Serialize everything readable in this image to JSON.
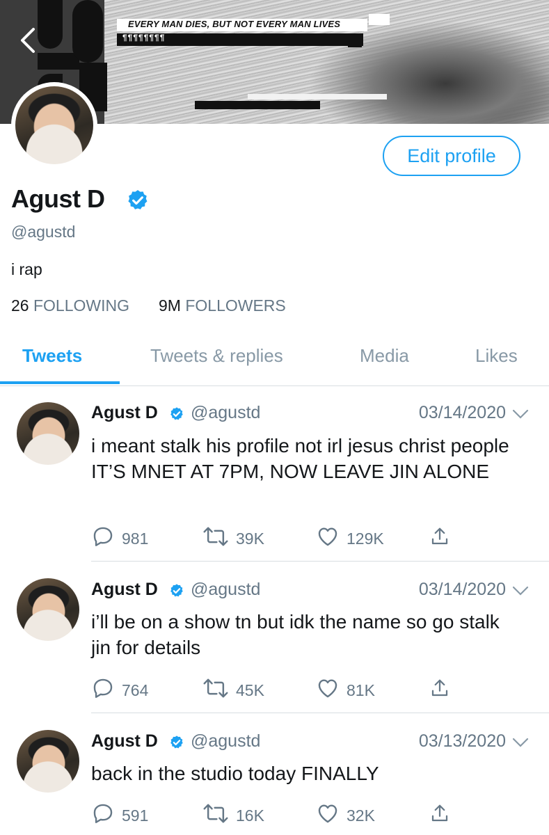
{
  "header": {
    "quote": "EVERY MAN DIES, BUT NOT EVERY MAN LIVES",
    "quote_sub": "¶¶¶¶¶¶¶¶"
  },
  "profile": {
    "edit_label": "Edit profile",
    "name": "Agust D",
    "handle": "@agustd",
    "bio": "i rap",
    "following_count": "26",
    "following_label": "FOLLOWING",
    "followers_count": "9M",
    "followers_label": "FOLLOWERS"
  },
  "tabs": [
    {
      "label": "Tweets",
      "active": true
    },
    {
      "label": "Tweets & replies",
      "active": false
    },
    {
      "label": "Media",
      "active": false
    },
    {
      "label": "Likes",
      "active": false
    }
  ],
  "tweets": [
    {
      "name": "Agust D",
      "handle": "@agustd",
      "date": "03/14/2020",
      "text": "i meant stalk his profile not irl jesus christ people IT’S MNET AT 7PM, NOW LEAVE JIN ALONE",
      "replies": "981",
      "retweets": "39K",
      "likes": "129K"
    },
    {
      "name": "Agust D",
      "handle": "@agustd",
      "date": "03/14/2020",
      "text": "i’ll be on a show tn but idk the name so go stalk jin for details",
      "replies": "764",
      "retweets": "45K",
      "likes": "81K"
    },
    {
      "name": "Agust D",
      "handle": "@agustd",
      "date": "03/13/2020",
      "text": "back in the studio today FINALLY",
      "replies": "591",
      "retweets": "16K",
      "likes": "32K"
    }
  ],
  "colors": {
    "accent": "#1da1f2",
    "muted": "#657786",
    "text": "#14171a"
  },
  "icons": [
    "back-chevron-icon",
    "verified-badge-icon",
    "reply-icon",
    "retweet-icon",
    "like-heart-icon",
    "share-icon",
    "chevron-down-icon"
  ]
}
